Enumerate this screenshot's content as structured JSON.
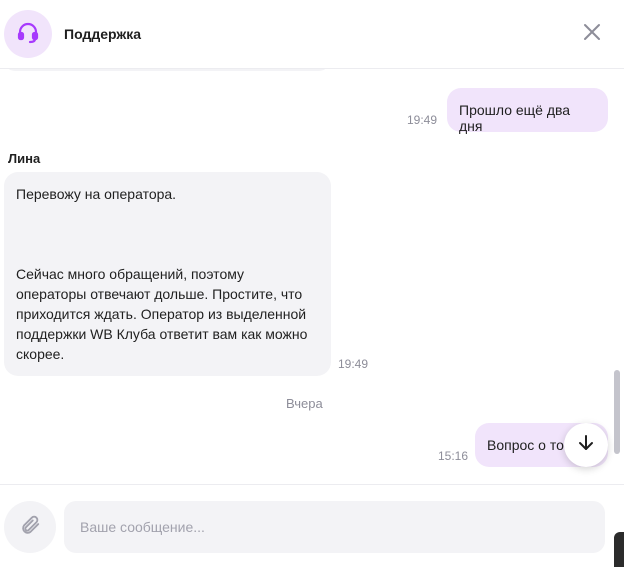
{
  "header": {
    "title": "Поддержка",
    "avatar_icon": "headset-icon",
    "close_icon": "close-icon",
    "accent_color": "#a73afd"
  },
  "messages": {
    "outgoing_1": {
      "text": "Прошло ещё два дня",
      "time": "19:49"
    },
    "incoming_1": {
      "sender": "Лина",
      "line1": "Перевожу на оператора.",
      "para2": [
        "Сейчас много обращений, поэтому",
        "операторы отвечают дольше. Простите, что",
        "приходится ждать. Оператор из выделенной",
        "поддержки WB Клуба ответит вам как можно",
        "скорее."
      ],
      "time": "19:49"
    },
    "date_separator": "Вчера",
    "outgoing_2": {
      "text": "Вопрос о то",
      "time": "15:16"
    }
  },
  "composer": {
    "placeholder": "Ваше сообщение...",
    "value": "",
    "attach_icon": "paperclip-icon"
  },
  "scroll_down_icon": "arrow-down-icon"
}
